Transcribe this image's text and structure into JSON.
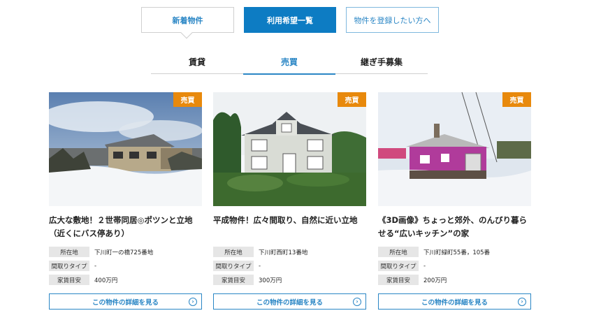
{
  "top_tabs": [
    {
      "label": "新着物件"
    },
    {
      "label": "利用希望一覧"
    },
    {
      "label": "物件を登録したい方へ"
    }
  ],
  "sub_tabs": [
    {
      "label": "賃貸"
    },
    {
      "label": "売買"
    },
    {
      "label": "継ぎ手募集"
    }
  ],
  "cards": [
    {
      "badge": "売買",
      "title": "広大な敷地！２世帯同居◎ポツンと立地（近くにバス停あり）",
      "rows": [
        {
          "label": "所在地",
          "value": "下川町一の橋725番地"
        },
        {
          "label": "間取りタイプ",
          "value": "-"
        },
        {
          "label": "家賃目安",
          "value": "400万円"
        }
      ],
      "button": "この物件の詳細を見る"
    },
    {
      "badge": "売買",
      "title": "平成物件！広々間取り、自然に近い立地",
      "rows": [
        {
          "label": "所在地",
          "value": "下川町西町13番地"
        },
        {
          "label": "間取りタイプ",
          "value": "-"
        },
        {
          "label": "家賃目安",
          "value": "300万円"
        }
      ],
      "button": "この物件の詳細を見る"
    },
    {
      "badge": "売買",
      "title": "《3D画像》ちょっと郊外、のんびり暮らせる“広いキッチン”の家",
      "rows": [
        {
          "label": "所在地",
          "value": "下川町緑町55番，105番"
        },
        {
          "label": "間取りタイプ",
          "value": "-"
        },
        {
          "label": "家賃目安",
          "value": "200万円"
        }
      ],
      "button": "この物件の詳細を見る"
    }
  ],
  "colors": {
    "accent": "#2a86c5",
    "active_tab": "#0d7cc3",
    "badge": "#e8890c"
  }
}
